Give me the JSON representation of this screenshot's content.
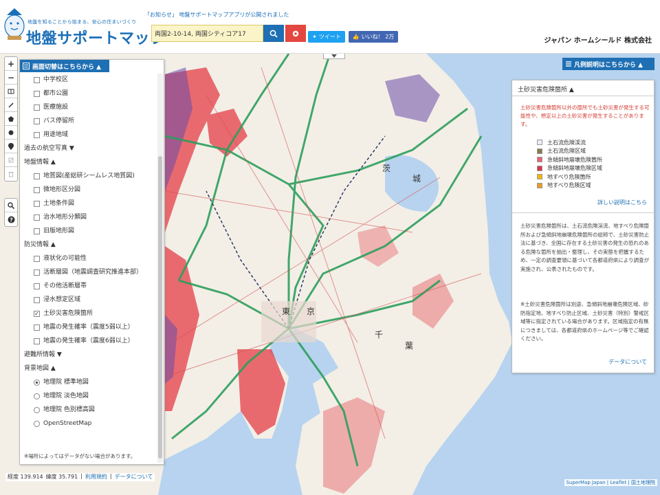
{
  "header": {
    "tagline": "地盤を知ることから始まる、安心の住まいづくり",
    "title": "地盤サポートマップ",
    "notice": "「お知らせ」 地盤サポートマップアプリが公開されました",
    "search_value": "両国2-10-14, 両国シティコア17",
    "tweet_label": "ツイート",
    "like_label": "いいね！ 2万",
    "company": "ジャパン ホームシールド 株式会社"
  },
  "layer_panel": {
    "header": "画面切替はこちらから ▲",
    "rows": [
      {
        "kind": "check",
        "label": "中学校区",
        "checked": false
      },
      {
        "kind": "check",
        "label": "都市公園",
        "checked": false
      },
      {
        "kind": "check",
        "label": "医療施設",
        "checked": false
      },
      {
        "kind": "check",
        "label": "バス停留所",
        "checked": false
      },
      {
        "kind": "check",
        "label": "用途地域",
        "checked": false
      },
      {
        "kind": "section",
        "label": "過去の航空写真 ▼"
      },
      {
        "kind": "section",
        "label": "地盤情報 ▲"
      },
      {
        "kind": "check",
        "label": "地質図(産総研シームレス地質図)",
        "checked": false
      },
      {
        "kind": "check",
        "label": "微地形区分図",
        "checked": false
      },
      {
        "kind": "check",
        "label": "土地条件図",
        "checked": false
      },
      {
        "kind": "check",
        "label": "治水地形分類図",
        "checked": false
      },
      {
        "kind": "check",
        "label": "旧版地形図",
        "checked": false
      },
      {
        "kind": "section",
        "label": "防災情報 ▲"
      },
      {
        "kind": "check",
        "label": "液状化の可能性",
        "checked": false
      },
      {
        "kind": "check",
        "label": "活断層図（地震調査研究推進本部）",
        "checked": false
      },
      {
        "kind": "check",
        "label": "その他活断層帯",
        "checked": false
      },
      {
        "kind": "check",
        "label": "浸水想定区域",
        "checked": false
      },
      {
        "kind": "check",
        "label": "土砂災害危険箇所",
        "checked": true
      },
      {
        "kind": "check",
        "label": "地震の発生確率（震度5弱以上）",
        "checked": false
      },
      {
        "kind": "check",
        "label": "地震の発生確率（震度6弱以上）",
        "checked": false
      },
      {
        "kind": "section",
        "label": "避難所情報 ▼"
      },
      {
        "kind": "section",
        "label": "背景地図 ▲"
      },
      {
        "kind": "radio",
        "label": "地理院 標準地図",
        "checked": true
      },
      {
        "kind": "radio",
        "label": "地理院 淡色地図",
        "checked": false
      },
      {
        "kind": "radio",
        "label": "地理院 色別標高図",
        "checked": false
      },
      {
        "kind": "radio",
        "label": "OpenStreetMap",
        "checked": false
      }
    ],
    "note": "※場所によってはデータがない場合があります。"
  },
  "legend": {
    "button": "凡例説明はこちらから ▲",
    "title": "土砂災害危険箇所 ▲",
    "warning": "土砂災害危険箇所以外の箇所でも土砂災害が発生する可能性や、想定以上の土砂災害が発生することがあります。",
    "items": [
      {
        "label": "土石流危険渓流",
        "color": "#ececf6"
      },
      {
        "label": "土石流危険区域",
        "color": "#8a7a4a"
      },
      {
        "label": "急傾斜地崩壊危険箇所",
        "color": "#e8637a"
      },
      {
        "label": "急傾斜地崩壊危険区域",
        "color": "#d9354a"
      },
      {
        "label": "地すべり危険箇所",
        "color": "#f1b800"
      },
      {
        "label": "地すべり危険区域",
        "color": "#ee9a1e"
      }
    ],
    "detail_link": "詳しい説明はこちら",
    "description": "土砂災害危険箇所は、土石流危険渓流、地すべり危険箇所および急傾斜地崩壊危険箇所の総称で、土砂災害防止法に基づき、全国に存在する土砂災害の発生の恐れのある危険な箇所を抽出・整理し、その実態を把握するため、一定の調査要領に基づいて各都道府県により調査が実施され、公表されたものです。",
    "description2": "※土砂災害危険箇所は別途、急傾斜地崩壊危険区域、砂防指定地、地すべり防止区域、土砂災害（特別）警戒区域等に指定されている場合があります。区域指定の有無につきましては、各都道府県のホームページ等でご確認ください。",
    "data_link": "データについて"
  },
  "map_labels": {
    "ibaraki_1": "茨",
    "ibaraki_2": "城",
    "chiba_1": "千",
    "chiba_2": "葉",
    "tokyo_1": "東",
    "tokyo_2": "京"
  },
  "footer": {
    "lon": "経度 139.914",
    "lat": "緯度 35.791",
    "terms": "利用規約",
    "about": "データについて",
    "attribution": "SuperMap Japan | Leaflet | 国土地理院"
  },
  "colors": {
    "accent": "#1e6fb3",
    "road": "#2e9e5c",
    "hazard": "#e2313c",
    "sea": "#b7d3ef"
  }
}
